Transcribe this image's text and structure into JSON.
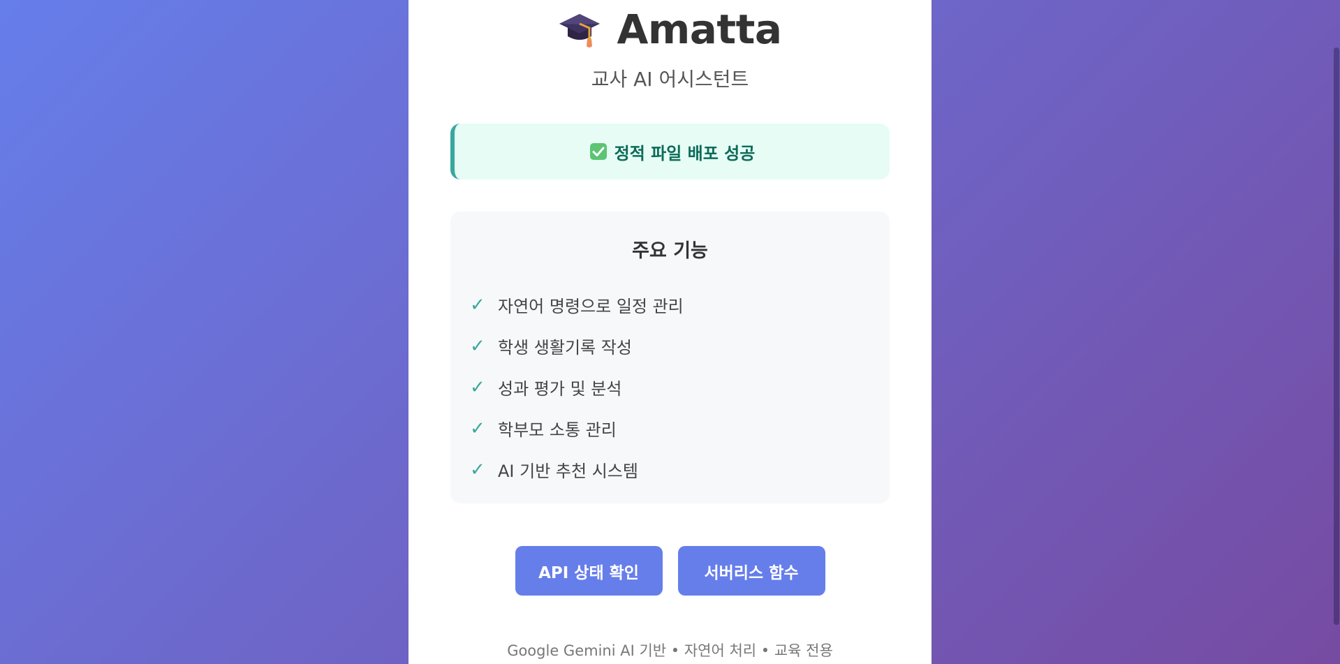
{
  "header": {
    "icon": "graduation-cap-icon",
    "title": "Amatta",
    "subtitle": "교사 AI 어시스턴트"
  },
  "status": {
    "icon": "check-mark-button-icon",
    "text": "정적 파일 배포 성공",
    "accent_color": "#38a89d",
    "background_color": "#e6fcf5"
  },
  "features": {
    "title": "주요 기능",
    "check_glyph": "✓",
    "items": [
      {
        "label": "자연어 명령으로 일정 관리"
      },
      {
        "label": "학생 생활기록 작성"
      },
      {
        "label": "성과 평가 및 분석"
      },
      {
        "label": "학부모 소통 관리"
      },
      {
        "label": "AI 기반 추천 시스템"
      }
    ]
  },
  "actions": {
    "api_status_label": "API 상태 확인",
    "serverless_label": "서버리스 함수",
    "button_color": "#667eea"
  },
  "footer": {
    "text": "Google Gemini AI 기반 • 자연어 처리 • 교육 전용"
  },
  "theme": {
    "background_gradient": [
      "#667eea",
      "#764ba2"
    ]
  }
}
